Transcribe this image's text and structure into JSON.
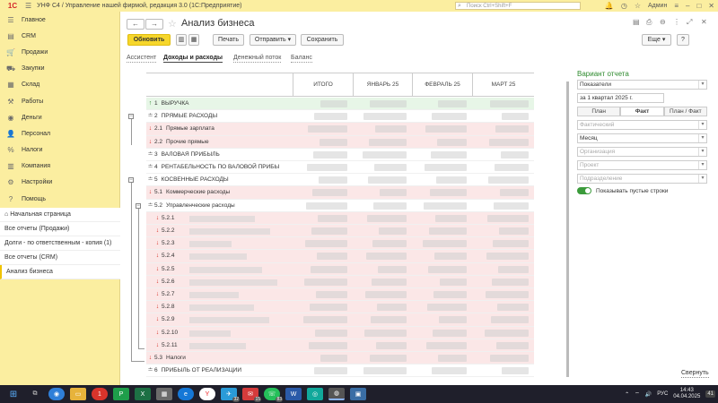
{
  "app": {
    "logo": "1С",
    "title": "УНФ С4 / Управление нашей фирмой, редакция 3.0  (1С:Предприятие)",
    "search_placeholder": "Поиск Ctrl+Shift+F",
    "user": "Админ"
  },
  "sidebar": {
    "items": [
      {
        "label": "Главное",
        "icon": "menu-icon"
      },
      {
        "label": "CRM",
        "icon": "crm-icon"
      },
      {
        "label": "Продажи",
        "icon": "cart-icon"
      },
      {
        "label": "Закупки",
        "icon": "truck-icon"
      },
      {
        "label": "Склад",
        "icon": "warehouse-icon"
      },
      {
        "label": "Работы",
        "icon": "tools-icon"
      },
      {
        "label": "Деньги",
        "icon": "coins-icon"
      },
      {
        "label": "Персонал",
        "icon": "person-icon"
      },
      {
        "label": "Налоги",
        "icon": "tax-icon"
      },
      {
        "label": "Компания",
        "icon": "building-icon"
      },
      {
        "label": "Настройки",
        "icon": "gear-icon"
      },
      {
        "label": "Помощь",
        "icon": "help-icon"
      }
    ],
    "open_windows": [
      {
        "label": "Начальная страница",
        "icon": "home-icon"
      },
      {
        "label": "Все отчеты (Продажи)"
      },
      {
        "label": "Долги - по ответственным - копия (1)"
      },
      {
        "label": "Все отчеты (CRM)"
      },
      {
        "label": "Анализ бизнеса"
      }
    ]
  },
  "header": {
    "back": "←",
    "forward": "→",
    "title": "Анализ бизнеса"
  },
  "toolbar": {
    "refresh": "Обновить",
    "print": "Печать",
    "send": "Отправить",
    "save": "Сохранить",
    "more": "Еще",
    "help": "?"
  },
  "tabs": [
    {
      "label": "Ассистент",
      "active": false
    },
    {
      "label": "Доходы и расходы",
      "active": true
    },
    {
      "label": "Денежный поток",
      "active": false
    },
    {
      "label": "Баланс",
      "active": false
    }
  ],
  "table": {
    "columns": [
      "ИТОГО",
      "ЯНВАРЬ 25",
      "ФЕВРАЛЬ 25",
      "МАРТ 25"
    ],
    "rows": [
      {
        "code": "1",
        "label": "ВЫРУЧКА",
        "arrow": "↑",
        "type": "income"
      },
      {
        "code": "2",
        "label": "ПРЯМЫЕ РАСХОДЫ",
        "arrow": "",
        "type": "group"
      },
      {
        "code": "2.1",
        "label": "Прямые зарплата",
        "arrow": "↓",
        "type": "expense"
      },
      {
        "code": "2.2",
        "label": "Прочие прямые",
        "arrow": "↓",
        "type": "expense"
      },
      {
        "code": "3",
        "label": "ВАЛОВАЯ ПРИБЫЛЬ",
        "arrow": "",
        "type": "calc"
      },
      {
        "code": "4",
        "label": "РЕНТАБЕЛЬНОСТЬ ПО ВАЛОВОЙ ПРИБЫ",
        "arrow": "",
        "type": "calc"
      },
      {
        "code": "5",
        "label": "КОСВЕННЫЕ РАСХОДЫ",
        "arrow": "",
        "type": "group"
      },
      {
        "code": "5.1",
        "label": "Коммерческие расходы",
        "arrow": "↓",
        "type": "expense"
      },
      {
        "code": "5.2",
        "label": "Управленческие расходы",
        "arrow": "",
        "type": "group"
      },
      {
        "code": "5.2.1",
        "label": "",
        "arrow": "↓",
        "type": "expense"
      },
      {
        "code": "5.2.2",
        "label": "",
        "arrow": "↓",
        "type": "expense"
      },
      {
        "code": "5.2.3",
        "label": "",
        "arrow": "↓",
        "type": "expense"
      },
      {
        "code": "5.2.4",
        "label": "",
        "arrow": "↓",
        "type": "expense"
      },
      {
        "code": "5.2.5",
        "label": "",
        "arrow": "↓",
        "type": "expense"
      },
      {
        "code": "5.2.6",
        "label": "",
        "arrow": "↓",
        "type": "expense"
      },
      {
        "code": "5.2.7",
        "label": "",
        "arrow": "↓",
        "type": "expense"
      },
      {
        "code": "5.2.8",
        "label": "",
        "arrow": "↓",
        "type": "expense"
      },
      {
        "code": "5.2.9",
        "label": "",
        "arrow": "↓",
        "type": "expense"
      },
      {
        "code": "5.2.10",
        "label": "",
        "arrow": "↓",
        "type": "expense"
      },
      {
        "code": "5.2.11",
        "label": "",
        "arrow": "↓",
        "type": "expense"
      },
      {
        "code": "5.3",
        "label": "Налоги",
        "arrow": "↓",
        "type": "expense"
      },
      {
        "code": "6",
        "label": "ПРИБЫЛЬ ОТ РЕАЛИЗАЦИИ",
        "arrow": "",
        "type": "calc"
      }
    ]
  },
  "right_panel": {
    "title": "Вариант отчета",
    "variant": "Показатели",
    "period": "за 1 квартал 2025 г.",
    "modes": [
      "План",
      "Факт",
      "План / Факт"
    ],
    "active_mode": "Факт",
    "scenario": "Фактический",
    "periodicity": "Месяц",
    "org_placeholder": "Организация",
    "project_placeholder": "Проект",
    "division_placeholder": "Подразделение",
    "show_empty": "Показывать пустые строки",
    "collapse": "Свернуть"
  },
  "taskbar": {
    "lang": "РУС",
    "time": "14:43",
    "date": "04.04.2025",
    "notif": "41",
    "badges": {
      "b1": "32",
      "b2": "15",
      "b3": "83"
    }
  },
  "colors": {
    "sidebar_bg": "#fbeea0",
    "primary_button": "#f6d62b",
    "income_row": "#e7f6e7",
    "expense_row": "#fbe7e7",
    "accent_green": "#2d8a2d"
  }
}
